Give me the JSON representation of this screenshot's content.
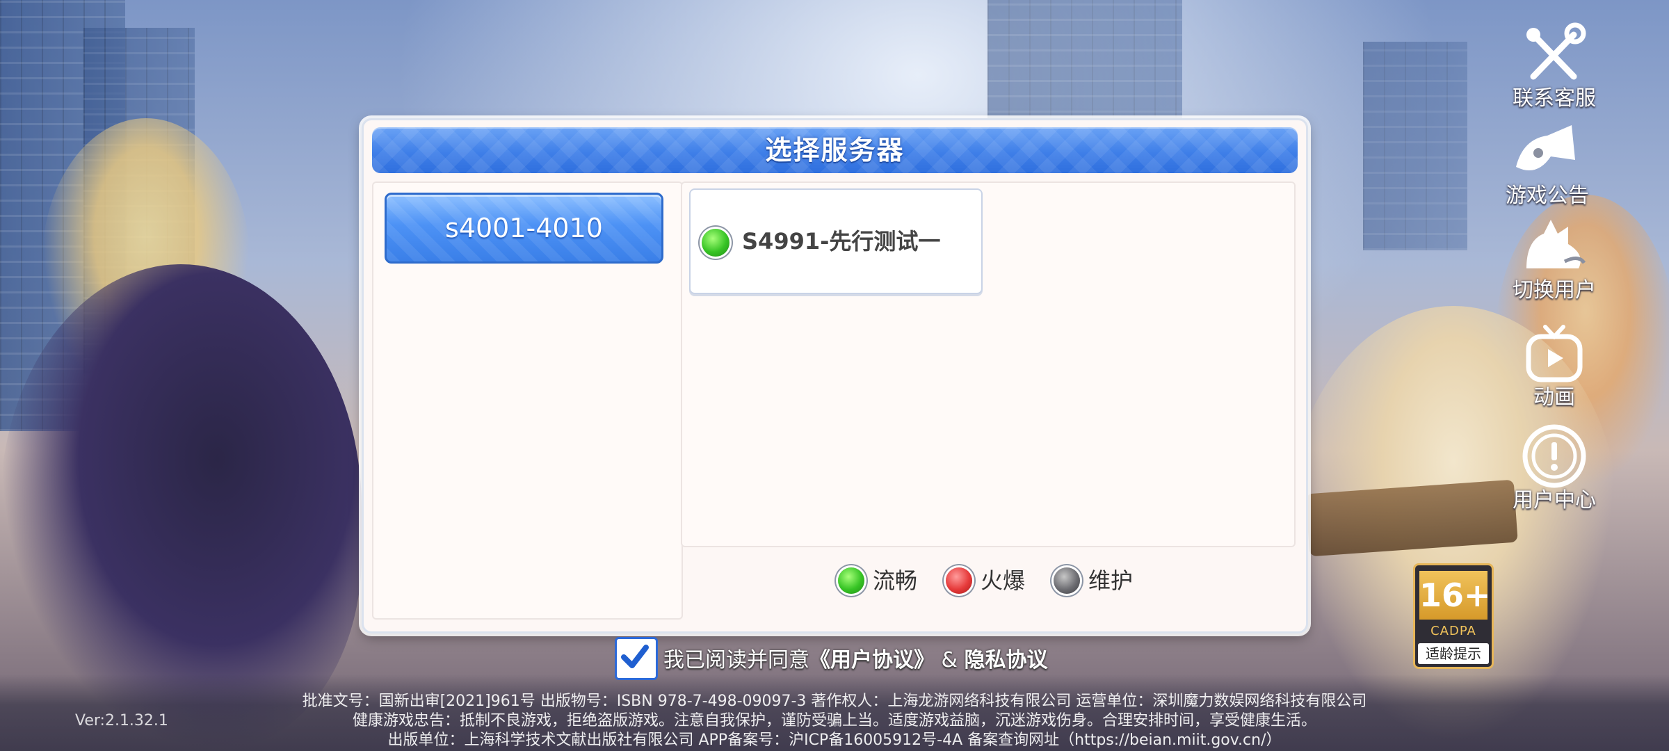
{
  "dialog": {
    "title": "选择服务器",
    "zones": [
      {
        "label": "s4001-4010",
        "selected": true
      }
    ],
    "servers": [
      {
        "name": "S4991-先行测试一",
        "status": "green"
      }
    ],
    "legend": [
      {
        "label": "流畅",
        "color": "green"
      },
      {
        "label": "火爆",
        "color": "red"
      },
      {
        "label": "维护",
        "color": "gray"
      }
    ]
  },
  "agreement": {
    "checked": true,
    "prefix": "我已阅读并同意",
    "user_agreement": "《用户协议》",
    "amp": " & ",
    "privacy": "隐私协议"
  },
  "side_menu": {
    "customer_service": "联系客服",
    "announcement": "游戏公告",
    "switch_user": "切换用户",
    "animation": "动画",
    "user_center": "用户中心"
  },
  "age_rating": {
    "number": "16+",
    "org": "CADPA",
    "tip": "适龄提示"
  },
  "footer": {
    "version": "Ver:2.1.32.1",
    "line1": "批准文号：国新出审[2021]961号  出版物号：ISBN 978-7-498-09097-3 著作权人：上海龙游网络科技有限公司 运营单位：深圳魔力数娱网络科技有限公司",
    "line2": "健康游戏忠告：抵制不良游戏，拒绝盗版游戏。注意自我保护，谨防受骗上当。适度游戏益脑，沉迷游戏伤身。合理安排时间，享受健康生活。",
    "line3": "出版单位：上海科学技术文献出版社有限公司 APP备案号：沪ICP备16005912号-4A 备案查询网址（https://beian.miit.gov.cn/）"
  },
  "colors": {
    "header_blue": "#3f7fe8",
    "status_green": "#37c425",
    "status_red": "#e63a3a",
    "status_gray": "#6d6d72"
  }
}
